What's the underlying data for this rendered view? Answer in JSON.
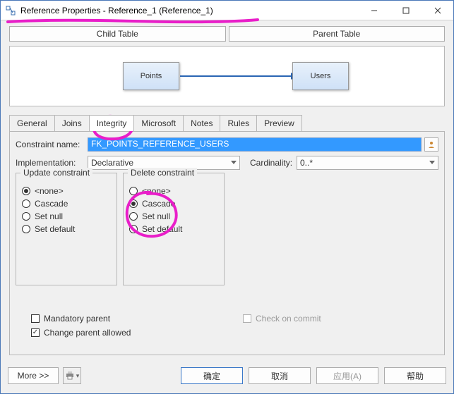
{
  "window": {
    "title": "Reference Properties - Reference_1 (Reference_1)"
  },
  "top_buttons": {
    "child": "Child Table",
    "parent": "Parent Table"
  },
  "diagram": {
    "left_entity": "Points",
    "right_entity": "Users"
  },
  "tabs": [
    "General",
    "Joins",
    "Integrity",
    "Microsoft",
    "Notes",
    "Rules",
    "Preview"
  ],
  "active_tab_index": 2,
  "integrity": {
    "constraint_name_label": "Constraint name:",
    "constraint_name_value": "FK_POINTS_REFERENCE_USERS",
    "implementation_label": "Implementation:",
    "implementation_value": "Declarative",
    "cardinality_label": "Cardinality:",
    "cardinality_value": "0..*",
    "update_group_label": "Update constraint",
    "delete_group_label": "Delete constraint",
    "options": {
      "none": "<none>",
      "cascade": "Cascade",
      "setnull": "Set null",
      "setdefault": "Set default"
    },
    "update_selected": "none",
    "delete_selected": "cascade",
    "mandatory_parent_label": "Mandatory parent",
    "mandatory_parent_checked": false,
    "change_parent_label": "Change parent allowed",
    "change_parent_checked": true,
    "check_on_commit_label": "Check on commit",
    "check_on_commit_checked": false
  },
  "dialog_buttons": {
    "more": "More >>",
    "ok": "确定",
    "cancel": "取消",
    "apply": "应用(A)",
    "help": "帮助"
  }
}
